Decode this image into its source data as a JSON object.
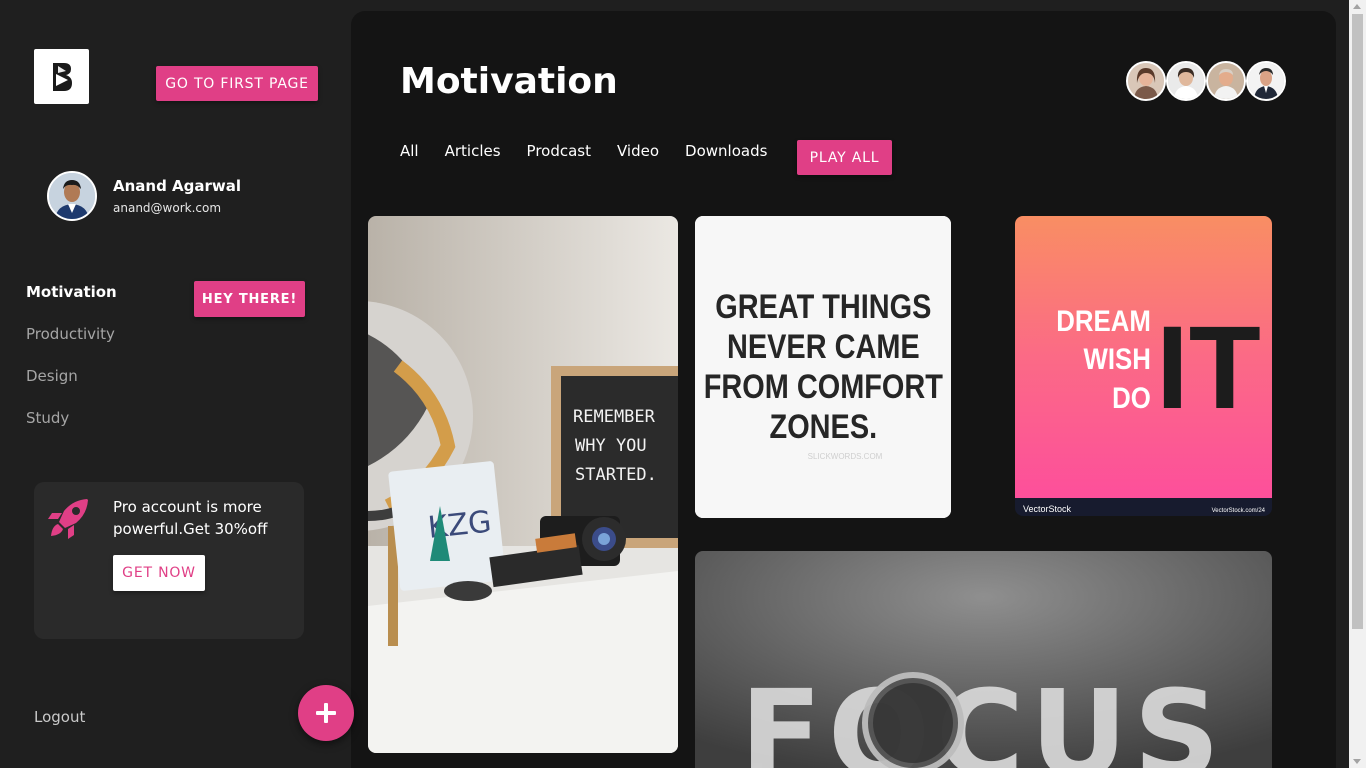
{
  "sidebar": {
    "go_first_label": "GO TO FIRST PAGE",
    "user": {
      "name": "Anand Agarwal",
      "email": "anand@work.com"
    },
    "nav": [
      "Motivation",
      "Productivity",
      "Design",
      "Study"
    ],
    "hey_label": "HEY THERE!",
    "promo": {
      "text": "Pro account is more powerful.Get 30%off",
      "button": "GET NOW"
    },
    "logout_label": "Logout"
  },
  "main": {
    "title": "Motivation",
    "tabs": [
      "All",
      "Articles",
      "Prodcast",
      "Video",
      "Downloads"
    ],
    "play_all_label": "PLAY ALL",
    "cards": {
      "letterboard": [
        "REMEMBER",
        "WHY YOU",
        "STARTED."
      ],
      "plate_text": "KZG",
      "quote_lines": [
        "GREAT THINGS",
        "NEVER CAME",
        "FROM COMFORT",
        "ZONES."
      ],
      "quote_source": "SLICKWORDS.COM",
      "dream_words": [
        "DREAM",
        "WISH",
        "DO"
      ],
      "dream_big": "IT",
      "stock_brand": "VectorStock",
      "stock_url": "VectorStock.com/24",
      "focus_word": "FOCUS"
    }
  },
  "colors": {
    "accent": "#e03f86",
    "sidebar_bg": "#1f1f1f",
    "main_bg": "#141414"
  },
  "icons": {
    "logo": "logo-b-icon",
    "rocket": "rocket-icon",
    "fab": "plus-icon"
  }
}
